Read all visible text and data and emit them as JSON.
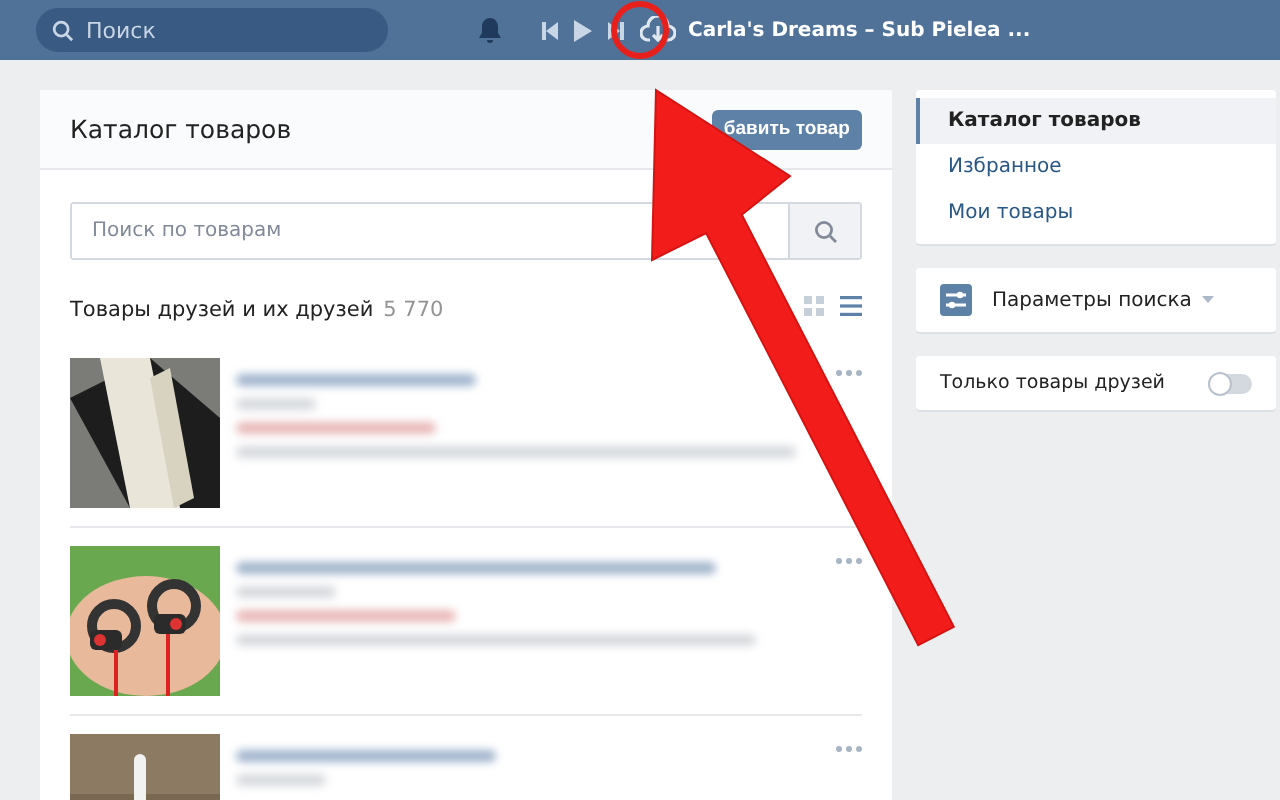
{
  "topbar": {
    "search": {
      "placeholder": "Поиск"
    },
    "now_playing": "Carla's Dreams – Sub Pielea ..."
  },
  "catalog": {
    "title": "Каталог товаров",
    "add_button": "бавить товар",
    "search": {
      "placeholder": "Поиск по товарам"
    },
    "section": {
      "title": "Товары друзей и их друзей",
      "count": "5 770"
    },
    "view_modes": [
      {
        "kind": "grid",
        "selected": false
      },
      {
        "kind": "list",
        "selected": true
      }
    ]
  },
  "sidebar": {
    "menu": [
      {
        "label": "Каталог товаров",
        "selected": true
      },
      {
        "label": "Избранное",
        "selected": false
      },
      {
        "label": "Мои товары",
        "selected": false
      }
    ],
    "search_params": "Параметры поиска",
    "friends_only": {
      "label": "Только товары друзей",
      "on": false
    }
  }
}
